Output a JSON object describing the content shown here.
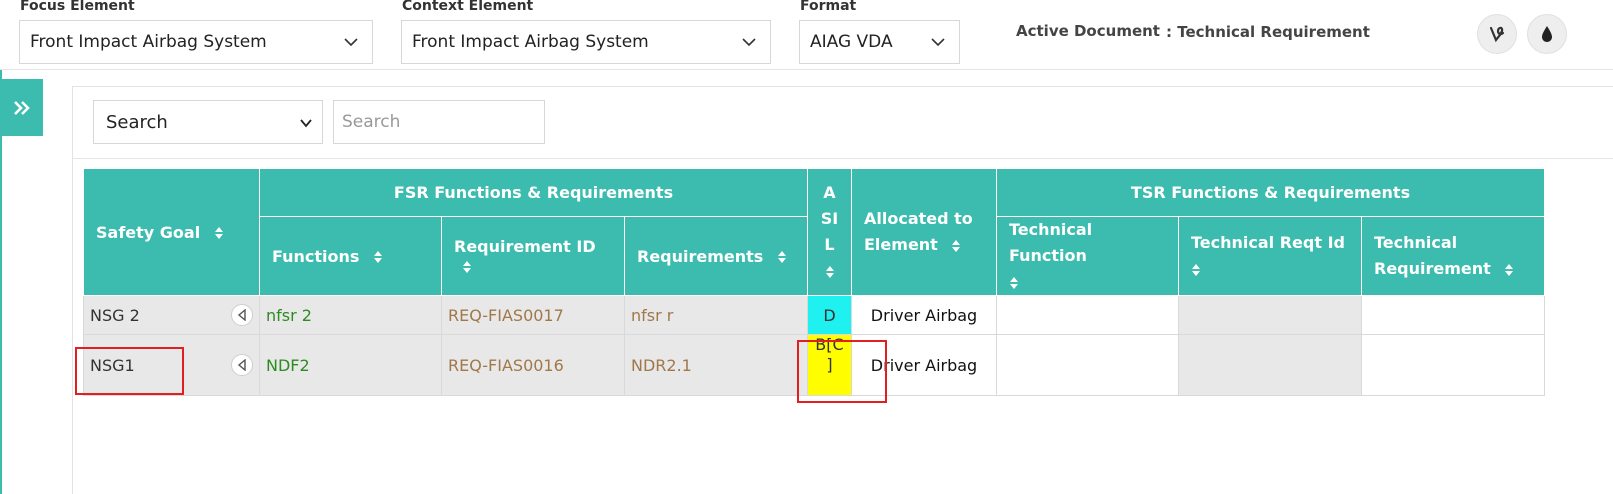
{
  "header": {
    "focus_label": "Focus Element",
    "focus_value": "Front Impact Airbag System",
    "context_label": "Context Element",
    "context_value": "Front Impact Airbag System",
    "format_label": "Format",
    "format_value": "AIAG VDA",
    "active_doc_label": "Active Document",
    "active_doc_value": ": Technical Requirement"
  },
  "search": {
    "select_value": "Search",
    "placeholder": "Search"
  },
  "table": {
    "group_fsr": "FSR Functions & Requirements",
    "group_tsr": "TSR Functions & Requirements",
    "col_safety_goal": "Safety Goal",
    "col_functions": "Functions",
    "col_requirement_id": "Requirement ID",
    "col_requirements": "Requirements",
    "col_asil_1": "A",
    "col_asil_2": "SI",
    "col_asil_3": "L",
    "col_allocated_1": "Allocated to",
    "col_allocated_2": "Element",
    "col_tech_function": "Technical Function",
    "col_tech_reqt_id": "Technical Reqt Id",
    "col_tech_req_1": "Technical",
    "col_tech_req_2": "Requirement",
    "rows": [
      {
        "safety_goal": "NSG 2",
        "function": "nfsr 2",
        "req_id": "REQ-FIAS0017",
        "requirement": "nfsr r",
        "asil": "D",
        "allocated": "Driver Airbag"
      },
      {
        "safety_goal": "NSG1",
        "function": "NDF2",
        "req_id": "REQ-FIAS0016",
        "requirement": "NDR2.1",
        "asil_1": "B[C",
        "asil_2": "]",
        "allocated": "Driver Airbag"
      }
    ]
  },
  "colors": {
    "accent": "#3cbcae",
    "asil_d": "#1ff0f0",
    "asil_b": "#fffd00",
    "highlight": "#e02020"
  }
}
